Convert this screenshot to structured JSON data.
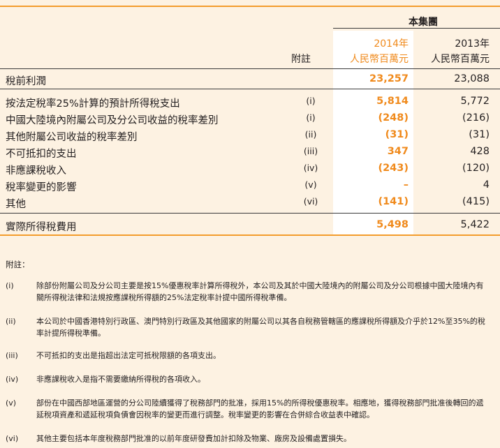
{
  "header": {
    "group": "本集團",
    "year_2014": "2014年",
    "unit_2014": "人民幣百萬元",
    "year_2013": "2013年",
    "unit_2013": "人民幣百萬元",
    "note_col": "附註"
  },
  "rows": [
    {
      "label": "稅前利潤",
      "note": "",
      "v2014": "23,257",
      "v2013": "23,088"
    },
    {
      "label": "按法定稅率25%計算的預計所得稅支出",
      "note": "(i)",
      "v2014": "5,814",
      "v2013": "5,772"
    },
    {
      "label": "中國大陸境內附屬公司及分公司收益的稅率差別",
      "note": "(i)",
      "v2014": "(248)",
      "v2013": "(216)"
    },
    {
      "label": "其他附屬公司收益的稅率差別",
      "note": "(ii)",
      "v2014": "(31)",
      "v2013": "(31)"
    },
    {
      "label": "不可抵扣的支出",
      "note": "(iii)",
      "v2014": "347",
      "v2013": "428"
    },
    {
      "label": "非應課稅收入",
      "note": "(iv)",
      "v2014": "(243)",
      "v2013": "(120)"
    },
    {
      "label": "稅率變更的影響",
      "note": "(v)",
      "v2014": "–",
      "v2013": "4"
    },
    {
      "label": "其他",
      "note": "(vi)",
      "v2014": "(141)",
      "v2013": "(415)"
    },
    {
      "label": "實際所得稅費用",
      "note": "",
      "v2014": "5,498",
      "v2013": "5,422"
    }
  ],
  "footnotes": {
    "title": "附註：",
    "items": [
      {
        "mark": "(i)",
        "text": "除部份附屬公司及分公司主要是按15%優惠稅率計算所得稅外，本公司及其於中國大陸境內的附屬公司及分公司根據中國大陸境內有關所得稅法律和法規按應課稅所得額的25%法定稅率計提中國所得稅準備。"
      },
      {
        "mark": "(ii)",
        "text": "本公司於中國香港特別行政區、澳門特別行政區及其他國家的附屬公司以其各自稅務管轄區的應課稅所得額及介乎於12%至35%的稅率計提所得稅準備。"
      },
      {
        "mark": "(iii)",
        "text": "不可抵扣的支出是指超出法定可抵稅限額的各項支出。"
      },
      {
        "mark": "(iv)",
        "text": "非應課稅收入是指不需要繳納所得稅的各項收入。"
      },
      {
        "mark": "(v)",
        "text": "部份在中國西部地區運營的分公司陸續獲得了稅務部門的批准，採用15%的所得稅優惠稅率。相應地，獲得稅務部門批准後轉回的遞延稅項資產和遞延稅項負債會因稅率的變更而進行調整。稅率變更的影響在合併綜合收益表中確認。"
      },
      {
        "mark": "(vi)",
        "text": "其他主要包括本年度稅務部門批准的以前年度研發費加計扣除及物業、廠房及設備處置損失。"
      }
    ]
  }
}
